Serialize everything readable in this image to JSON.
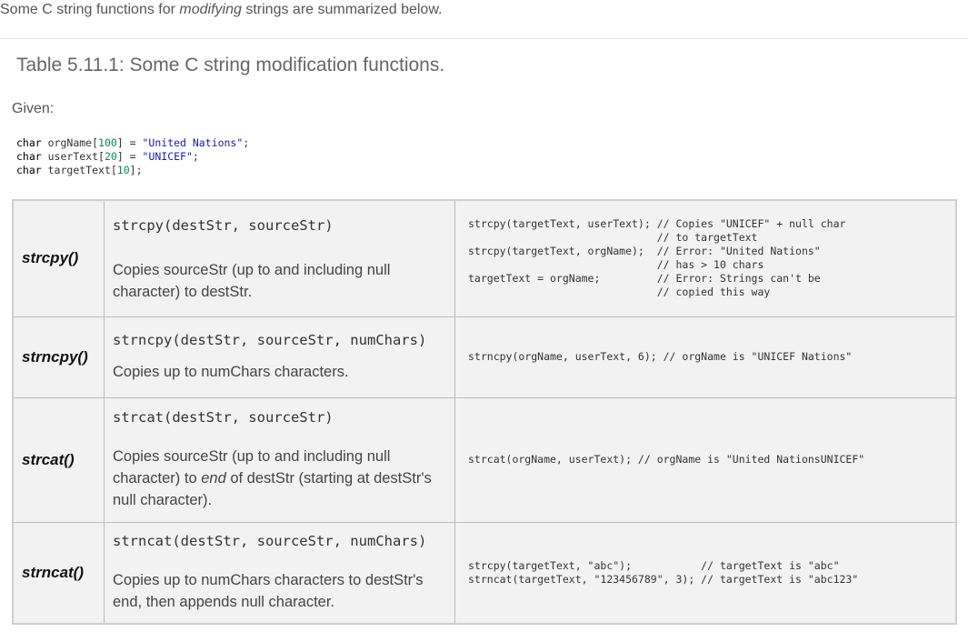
{
  "intro": {
    "before": "Some C string functions for ",
    "emph": "modifying",
    "after": " strings are summarized below."
  },
  "caption": "Table 5.11.1: Some C string modification functions.",
  "given_label": "Given:",
  "given_code": [
    {
      "kw": "char",
      "rest_a": " orgName[",
      "num": "100",
      "rest_b": "] = ",
      "str": "\"United Nations\"",
      "end": ";"
    },
    {
      "kw": "char",
      "rest_a": " userText[",
      "num": "20",
      "rest_b": "] = ",
      "str": "\"UNICEF\"",
      "end": ";"
    },
    {
      "kw": "char",
      "rest_a": " targetText[",
      "num": "10",
      "rest_b": "];",
      "str": "",
      "end": ""
    }
  ],
  "rows": [
    {
      "name": "strcpy()",
      "signature": "strcpy(destStr, sourceStr)",
      "description_before": "Copies sourceStr (up to and including null character) to destStr.",
      "description_emph": "",
      "description_after": "",
      "example": "strcpy(targetText, userText); // Copies \"UNICEF\" + null char\n                              // to targetText\nstrcpy(targetText, orgName);  // Error: \"United Nations\"\n                              // has > 10 chars\ntargetText = orgName;         // Error: Strings can't be\n                              // copied this way"
    },
    {
      "name": "strncpy()",
      "signature": "strncpy(destStr, sourceStr, numChars)",
      "description_before": "Copies up to numChars characters.",
      "description_emph": "",
      "description_after": "",
      "example": "strncpy(orgName, userText, 6); // orgName is \"UNICEF Nations\""
    },
    {
      "name": "strcat()",
      "signature": "strcat(destStr, sourceStr)",
      "description_before": "Copies sourceStr (up to and including null character) to ",
      "description_emph": "end",
      "description_after": " of destStr (starting at destStr's null character).",
      "example": "strcat(orgName, userText); // orgName is \"United NationsUNICEF\""
    },
    {
      "name": "strncat()",
      "signature": "strncat(destStr, sourceStr, numChars)",
      "description_before": "Copies up to numChars characters to destStr's end, then appends null character.",
      "description_emph": "",
      "description_after": "",
      "example": "strcpy(targetText, \"abc\");           // targetText is \"abc\"\nstrncat(targetText, \"123456789\", 3); // targetText is \"abc123\""
    }
  ]
}
